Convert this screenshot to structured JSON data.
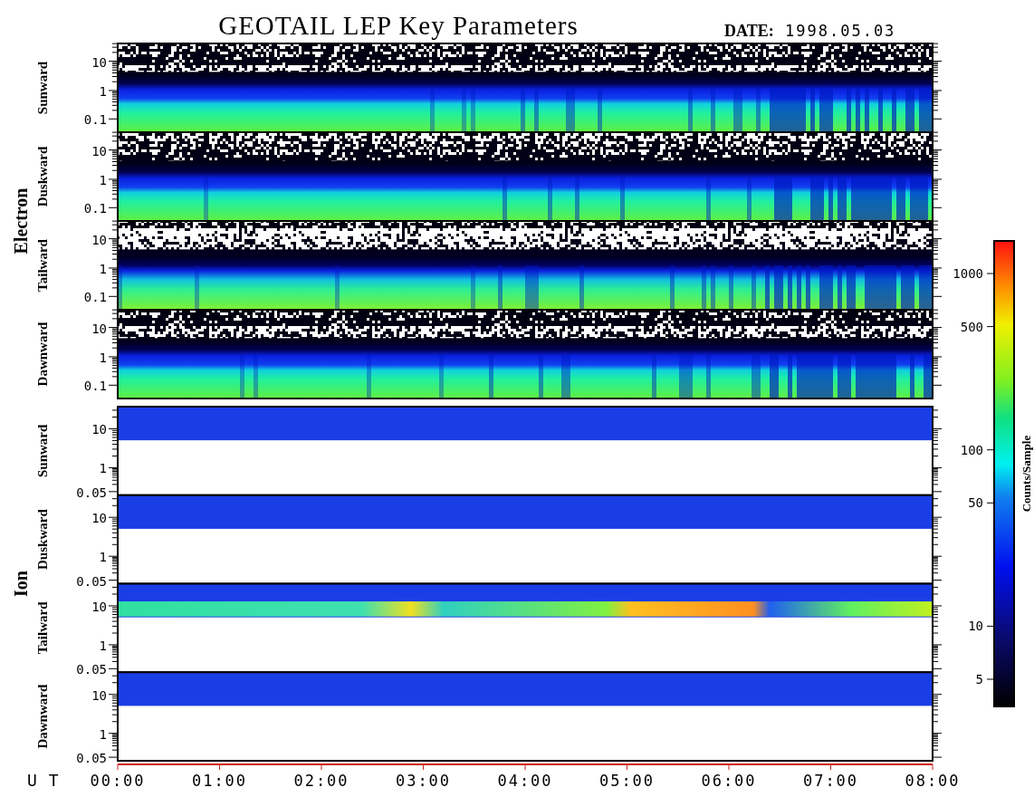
{
  "title": "GEOTAIL LEP Key Parameters",
  "date": {
    "label": "DATE:",
    "value": "1998.05.03"
  },
  "groups": [
    {
      "label": "Electron",
      "kind": "electron",
      "panels": [
        {
          "label": "Sunward",
          "kind": "electron",
          "yticks": [
            "10",
            "1",
            "0.1"
          ]
        },
        {
          "label": "Duskward",
          "kind": "electron",
          "yticks": [
            "10",
            "1",
            "0.1"
          ]
        },
        {
          "label": "Tailward",
          "kind": "electron-dense",
          "yticks": [
            "10",
            "1",
            "0.1"
          ]
        },
        {
          "label": "Dawnward",
          "kind": "electron",
          "yticks": [
            "10",
            "1",
            "0.1"
          ]
        }
      ]
    },
    {
      "label": "Ion",
      "kind": "ion",
      "panels": [
        {
          "label": "Sunward",
          "kind": "ion",
          "yticks": [
            "10",
            "1",
            "0.05"
          ]
        },
        {
          "label": "Duskward",
          "kind": "ion",
          "yticks": [
            "10",
            "1",
            "0.05"
          ]
        },
        {
          "label": "Tailward",
          "kind": "ion-beam",
          "yticks": [
            "10",
            "1",
            "0.05"
          ]
        },
        {
          "label": "Dawnward",
          "kind": "ion",
          "yticks": [
            "10",
            "1",
            "0.05"
          ]
        }
      ]
    }
  ],
  "colorbar": {
    "label": "Counts/Sample",
    "ticks": [
      "1000",
      "500",
      "100",
      "50",
      "10",
      "5"
    ]
  },
  "time_axis": {
    "label": "U T",
    "ticks": [
      "00:00",
      "01:00",
      "02:00",
      "03:00",
      "04:00",
      "05:00",
      "06:00",
      "07:00",
      "08:00"
    ]
  }
}
